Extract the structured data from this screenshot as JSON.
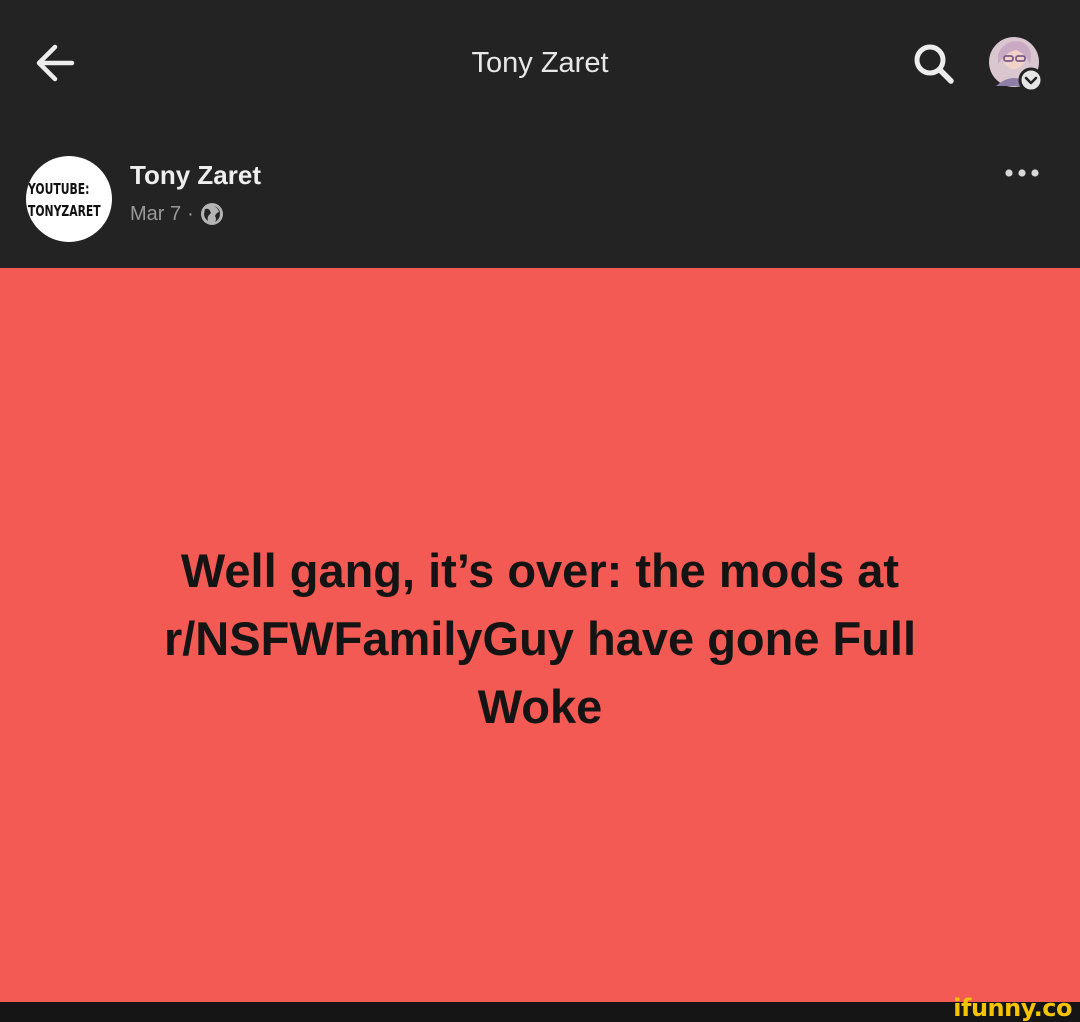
{
  "topbar": {
    "title": "Tony Zaret",
    "back_icon": "arrow-left-icon",
    "search_icon": "search-icon",
    "avatar_icon": "profile-avatar"
  },
  "post": {
    "author": {
      "name": "Tony Zaret",
      "avatar_text_line1": "YOUTUBE:",
      "avatar_text_line2": "TONYZARET"
    },
    "date": "Mar 7",
    "separator": "·",
    "privacy_icon": "globe-icon",
    "more_icon": "more-horizontal-icon",
    "text": "Well gang, it’s over: the mods at r/NSFWFamilyGuy have gone Full Woke",
    "background_color": "#f35a54"
  },
  "watermark": "ifunny.co",
  "colors": {
    "bar": "#232323",
    "post_background": "#f35a54",
    "watermark": "#f4c400"
  }
}
